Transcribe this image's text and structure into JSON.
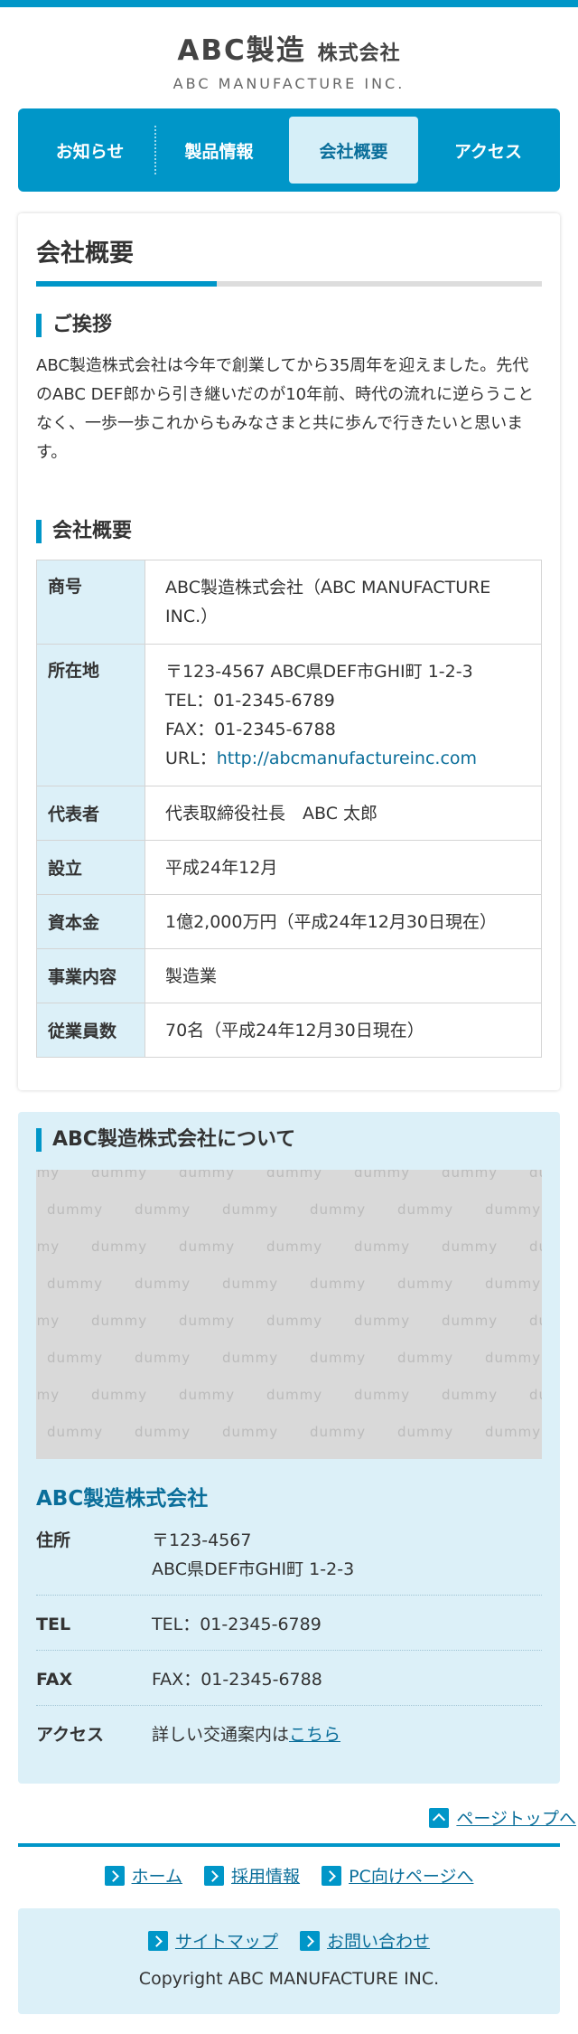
{
  "colors": {
    "accent": "#0096c8",
    "accent_light": "#dcf0f8",
    "link": "#0a6e9a"
  },
  "header": {
    "logo_main": "ABC製造",
    "logo_main_small": "株式会社",
    "logo_sub": "ABC MANUFACTURE INC."
  },
  "nav": {
    "items": [
      {
        "label": "お知らせ"
      },
      {
        "label": "製品情報"
      },
      {
        "label": "会社概要"
      },
      {
        "label": "アクセス"
      }
    ]
  },
  "main": {
    "page_title": "会社概要",
    "greeting": {
      "heading": "ご挨拶",
      "text": "ABC製造株式会社は今年で創業してから35周年を迎えました。先代のABC DEF郎から引き継いだのが10年前、時代の流れに逆らうことなく、一歩一歩これからもみなさまと共に歩んで行きたいと思います。"
    },
    "profile": {
      "heading": "会社概要",
      "rows": [
        {
          "key": "商号",
          "value": "ABC製造株式会社（ABC MANUFACTURE INC.）"
        },
        {
          "key": "所在地",
          "address": "〒123-4567 ABC県DEF市GHI町 1-2-3",
          "tel": "TEL：01-2345-6789",
          "fax": "FAX：01-2345-6788",
          "url_prefix": "URL：",
          "url": "http://abcmanufactureinc.com"
        },
        {
          "key": "代表者",
          "value": "代表取締役社長　ABC 太郎"
        },
        {
          "key": "設立",
          "value": "平成24年12月"
        },
        {
          "key": "資本金",
          "value": "1億2,000万円（平成24年12月30日現在）"
        },
        {
          "key": "事業内容",
          "value": "製造業"
        },
        {
          "key": "従業員数",
          "value": "70名（平成24年12月30日現在）"
        }
      ]
    }
  },
  "about": {
    "heading": "ABC製造株式会社について",
    "map_watermark": "dummy",
    "company_name": "ABC製造株式会社",
    "rows": [
      {
        "key": "住所",
        "line1": "〒123-4567",
        "line2": "ABC県DEF市GHI町 1-2-3"
      },
      {
        "key": "TEL",
        "value": "TEL：01-2345-6789"
      },
      {
        "key": "FAX",
        "value": "FAX：01-2345-6788"
      },
      {
        "key": "アクセス",
        "value": "詳しい交通案内は",
        "link": "こちら"
      }
    ]
  },
  "footer": {
    "pagetop": "ページトップへ",
    "nav1": [
      "ホーム",
      "採用情報",
      "PC向けページへ"
    ],
    "nav2": [
      "サイトマップ",
      "お問い合わせ"
    ],
    "copyright": "Copyright ABC MANUFACTURE INC."
  }
}
